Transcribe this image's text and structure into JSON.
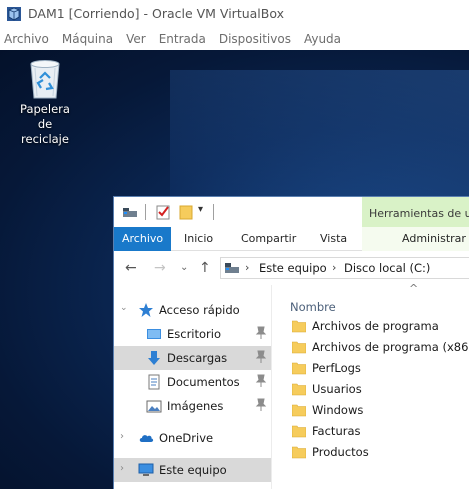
{
  "vbox": {
    "title": "DAM1 [Corriendo] - Oracle VM VirtualBox",
    "menu": [
      "Archivo",
      "Máquina",
      "Ver",
      "Entrada",
      "Dispositivos",
      "Ayuda"
    ]
  },
  "desktop": {
    "recycle_bin_label_line1": "Papelera de",
    "recycle_bin_label_line2": "reciclaje"
  },
  "explorer": {
    "tools_tab_label": "Herramientas de unidad",
    "ribbon_tabs": {
      "file": "Archivo",
      "home": "Inicio",
      "share": "Compartir",
      "view": "Vista",
      "manage": "Administrar"
    },
    "address": {
      "segment1": "Este equipo",
      "segment2": "Disco local (C:)"
    },
    "nav": {
      "quick_access": "Acceso rápido",
      "desktop": "Escritorio",
      "downloads": "Descargas",
      "documents": "Documentos",
      "images": "Imágenes",
      "onedrive": "OneDrive",
      "this_pc": "Este equipo"
    },
    "content": {
      "column_name": "Nombre",
      "items": [
        "Archivos de programa",
        "Archivos de programa (x86)",
        "PerfLogs",
        "Usuarios",
        "Windows",
        "Facturas",
        "Productos"
      ]
    }
  },
  "colors": {
    "accent": "#1979ca",
    "tools_tab": "#d9f2c7",
    "folder": "#f6cc5c",
    "selected_nav": "#d9d9d9"
  }
}
